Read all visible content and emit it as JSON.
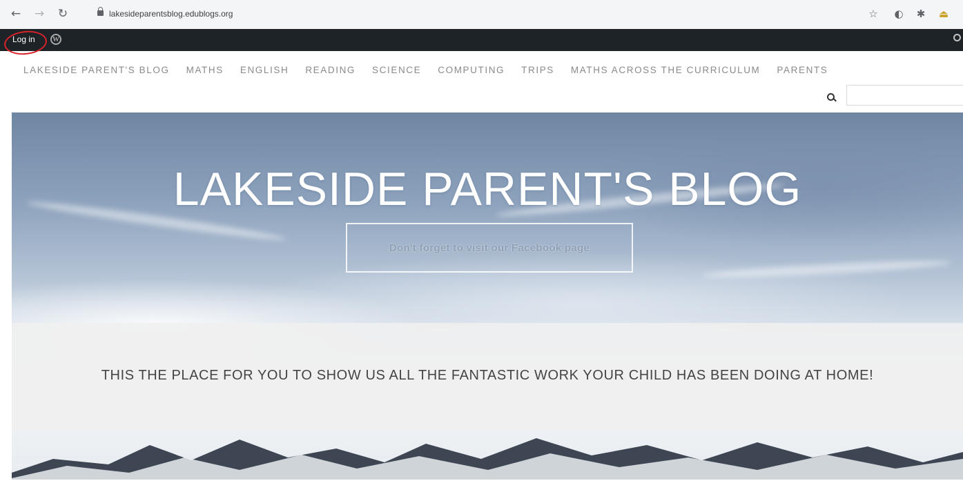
{
  "browser": {
    "url": "lakesideparentsblog.edublogs.org",
    "icons": [
      "back-arrow-icon",
      "forward-arrow-icon",
      "reload-icon",
      "lock-icon",
      "bookmark-star-icon",
      "extension-icon",
      "puzzle-icon",
      "download-icon"
    ]
  },
  "adminbar": {
    "login_label": "Log in",
    "wp_logo_glyph": "W"
  },
  "nav": {
    "items": [
      {
        "label": "LAKESIDE PARENT'S BLOG"
      },
      {
        "label": "MATHS"
      },
      {
        "label": "ENGLISH"
      },
      {
        "label": "READING"
      },
      {
        "label": "SCIENCE"
      },
      {
        "label": "COMPUTING"
      },
      {
        "label": "TRIPS"
      },
      {
        "label": "MATHS ACROSS THE CURRICULUM"
      },
      {
        "label": "PARENTS"
      }
    ],
    "search_value": ""
  },
  "hero": {
    "title": "LAKESIDE PARENT'S BLOG",
    "button_label": "Don't forget to visit our Facebook page",
    "tagline": "THIS THE PLACE FOR YOU TO SHOW US ALL THE FANTASTIC WORK YOUR CHILD HAS BEEN DOING AT HOME!"
  },
  "colors": {
    "adminbar_bg": "#1d2327",
    "highlight_ring": "#d8232a",
    "nav_text": "#8a8a8a"
  }
}
